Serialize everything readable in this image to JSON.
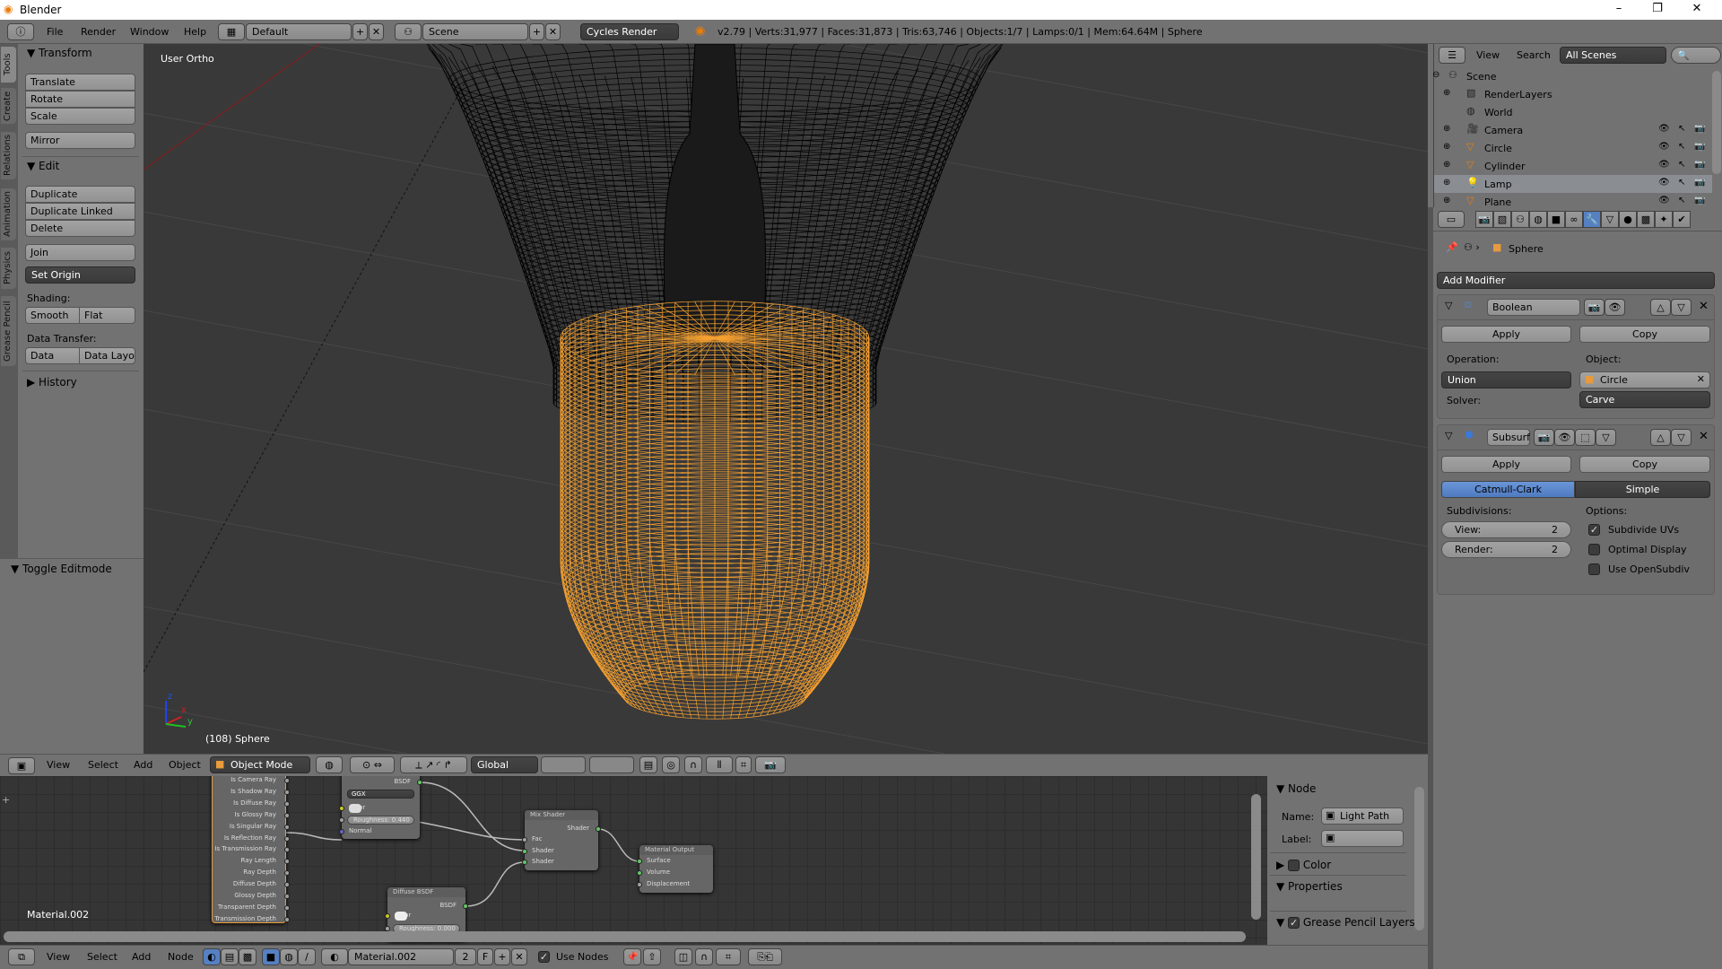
{
  "window": {
    "title": "Blender",
    "minimize": "–",
    "maximize": "❐",
    "close": "✕"
  },
  "topbar": {
    "menus": [
      "File",
      "Render",
      "Window",
      "Help"
    ],
    "layout": "Default",
    "scene": "Scene",
    "engine": "Cycles Render",
    "stats": "v2.79 | Verts:31,977 | Faces:31,873 | Tris:63,746 | Objects:1/7 | Lamps:0/1 | Mem:64.64M | Sphere"
  },
  "tool_tabs": [
    "Tools",
    "Create",
    "Relations",
    "Animation",
    "Physics",
    "Grease Pencil"
  ],
  "tool_shelf": {
    "transform": {
      "title": "Transform",
      "buttons": [
        "Translate",
        "Rotate",
        "Scale",
        "Mirror"
      ]
    },
    "edit": {
      "title": "Edit",
      "buttons": [
        "Duplicate",
        "Duplicate Linked",
        "Delete",
        "Join"
      ],
      "set_origin": "Set Origin",
      "shading_label": "Shading:",
      "smooth": "Smooth",
      "flat": "Flat",
      "data_transfer_label": "Data Transfer:",
      "data": "Data",
      "data_layout": "Data Layo"
    },
    "history": "History",
    "toggle_editmode": "Toggle Editmode"
  },
  "viewport": {
    "view_name": "User Ortho",
    "object_info": "(108) Sphere",
    "axis": {
      "x": "x",
      "y": "y",
      "z": "z"
    },
    "colors": {
      "background": "#393939",
      "selected_wire": "#f5a030",
      "wire": "#000000"
    }
  },
  "view3d_header": {
    "menus": [
      "View",
      "Select",
      "Add",
      "Object"
    ],
    "mode": "Object Mode",
    "orientation": "Global"
  },
  "node_editor": {
    "material_label": "Material.002",
    "light_path": {
      "outputs": [
        "Is Camera Ray",
        "Is Shadow Ray",
        "Is Diffuse Ray",
        "Is Glossy Ray",
        "Is Singular Ray",
        "Is Reflection Ray",
        "Is Transmission Ray",
        "Ray Length",
        "Ray Depth",
        "Diffuse Depth",
        "Glossy Depth",
        "Transparent Depth",
        "Transmission Depth"
      ]
    },
    "glossy": {
      "output": "BSDF",
      "distribution": "GGX",
      "color": "Color",
      "roughness": "Roughness: 0.440",
      "normal": "Normal"
    },
    "mix": {
      "title": "Mix Shader",
      "output": "Shader",
      "inputs": [
        "Fac",
        "Shader",
        "Shader"
      ]
    },
    "output": {
      "title": "Material Output",
      "inputs": [
        "Surface",
        "Volume",
        "Displacement"
      ]
    },
    "diffuse": {
      "title": "Diffuse BSDF",
      "output": "BSDF",
      "color": "Color",
      "roughness": "Roughness: 0.000"
    },
    "sidebar": {
      "node_title": "Node",
      "name_label": "Name:",
      "name_value": "Light Path",
      "label_label": "Label:",
      "label_value": "",
      "color": "Color",
      "properties": "Properties",
      "grease_pencil": "Grease Pencil Layers"
    }
  },
  "node_header": {
    "menus": [
      "View",
      "Select",
      "Add",
      "Node"
    ],
    "material": "Material.002",
    "users": "2",
    "fake": "F",
    "use_nodes": "Use Nodes",
    "use_nodes_checked": true
  },
  "outliner": {
    "view": "View",
    "search": "Search",
    "filter": "All Scenes",
    "items": [
      {
        "name": "Scene",
        "icon": "scene-icon"
      },
      {
        "name": "RenderLayers",
        "icon": "render-layers-icon"
      },
      {
        "name": "World",
        "icon": "world-icon"
      },
      {
        "name": "Camera",
        "icon": "camera-icon"
      },
      {
        "name": "Circle",
        "icon": "mesh-icon"
      },
      {
        "name": "Cylinder",
        "icon": "mesh-icon"
      },
      {
        "name": "Lamp",
        "icon": "lamp-icon",
        "selected": true
      },
      {
        "name": "Plane",
        "icon": "mesh-icon"
      }
    ]
  },
  "properties": {
    "object": "Sphere",
    "add_modifier": "Add Modifier",
    "boolean": {
      "name": "Boolean",
      "apply": "Apply",
      "copy": "Copy",
      "operation_label": "Operation:",
      "operation": "Union",
      "object_label": "Object:",
      "object": "Circle",
      "solver_label": "Solver:",
      "solver": "Carve"
    },
    "subsurf": {
      "name": "Subsurf",
      "apply": "Apply",
      "copy": "Copy",
      "catmull": "Catmull-Clark",
      "simple": "Simple",
      "active": "Catmull-Clark",
      "subdivisions_label": "Subdivisions:",
      "view": "View:",
      "view_value": "2",
      "render": "Render:",
      "render_value": "2",
      "options_label": "Options:",
      "subdivide_uvs": "Subdivide UVs",
      "subdivide_uvs_checked": true,
      "optimal_display": "Optimal Display",
      "optimal_display_checked": false,
      "use_opensubdiv": "Use OpenSubdiv",
      "use_opensubdiv_checked": false
    },
    "accent": "#5680c2"
  }
}
